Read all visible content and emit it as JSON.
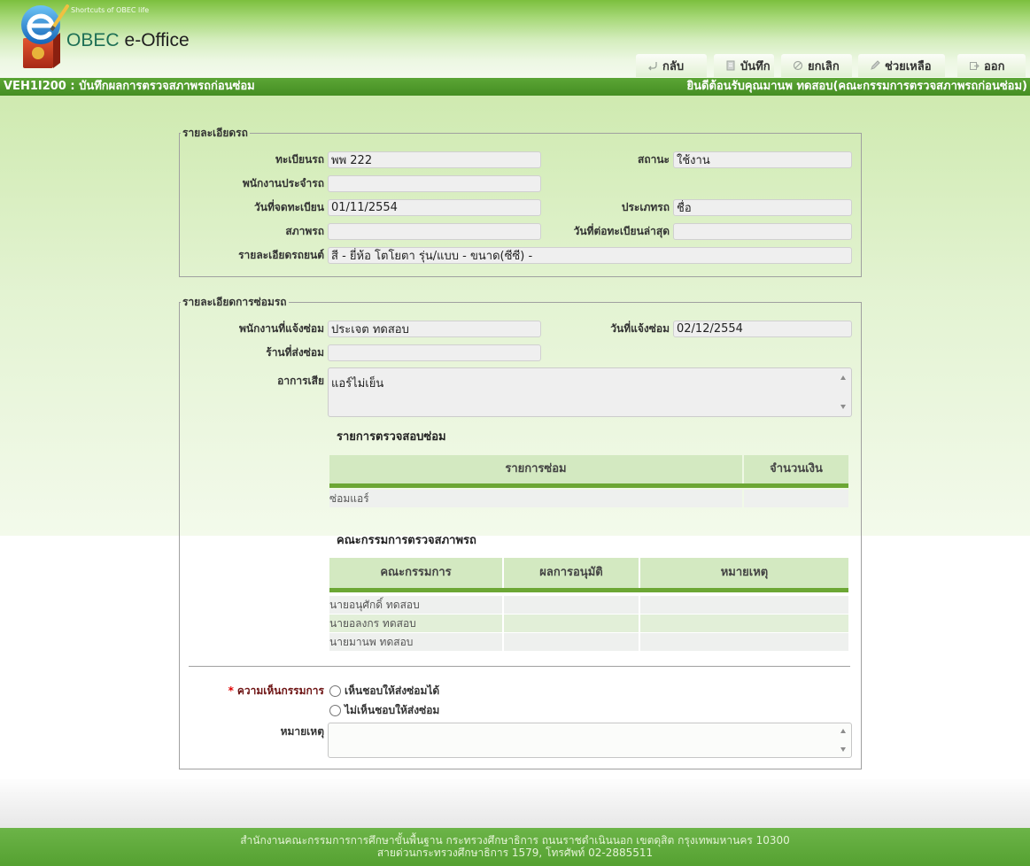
{
  "app": {
    "tagline": "Shortcuts of OBEC life",
    "brand_obec": "OBEC",
    "brand_office": "e-Office",
    "logo_icon": "obec-e-office-logo"
  },
  "toolbar": {
    "back": {
      "label": "กลับ",
      "icon": "back-arrow-icon"
    },
    "save": {
      "label": "บันทึก",
      "icon": "save-document-icon"
    },
    "cancel": {
      "label": "ยกเลิก",
      "icon": "cancel-circle-icon"
    },
    "help": {
      "label": "ช่วยเหลือ",
      "icon": "help-pen-icon"
    },
    "exit": {
      "label": "ออก",
      "icon": "exit-icon"
    }
  },
  "title_bar": {
    "page_title": "VEH1I200 : บันทึกผลการตรวจสภาพรถก่อนซ่อม",
    "welcome": "ยินดีต้อนรับคุณมานพ ทดสอบ(คณะกรรมการตรวจสภาพรถก่อนซ่อม)"
  },
  "vehicle_details": {
    "legend": "รายละเอียดรถ",
    "plate": {
      "label": "ทะเบียนรถ",
      "value": "พพ 222"
    },
    "status": {
      "label": "สถานะ",
      "value": "ใช้งาน"
    },
    "driver": {
      "label": "พนักงานประจำรถ",
      "value": ""
    },
    "registration_date": {
      "label": "วันที่จดทะเบียน",
      "value": "01/11/2554"
    },
    "vehicle_type": {
      "label": "ประเภทรถ",
      "value": "ชื่อ"
    },
    "condition": {
      "label": "สภาพรถ",
      "value": ""
    },
    "last_renewal_date": {
      "label": "วันที่ต่อทะเบียนล่าสุด",
      "value": ""
    },
    "description": {
      "label": "รายละเอียดรถยนต์",
      "value": "สี - ยี่ห้อ โตโยตา รุ่น/แบบ - ขนาด(ซีซี) -"
    }
  },
  "repair_details": {
    "legend": "รายละเอียดการซ่อมรถ",
    "reporter": {
      "label": "พนักงานที่แจ้งซ่อม",
      "value": "ประเจต ทดสอบ"
    },
    "report_date": {
      "label": "วันที่แจ้งซ่อม",
      "value": "02/12/2554"
    },
    "shop": {
      "label": "ร้านที่ส่งซ่อม",
      "value": ""
    },
    "symptom": {
      "label": "อาการเสีย",
      "value": "แอร์ไม่เย็น"
    },
    "checklist": {
      "title": "รายการตรวจสอบซ่อม",
      "headers": [
        "รายการซ่อม",
        "จำนวนเงิน"
      ],
      "rows": [
        [
          "ซ่อมแอร์",
          ""
        ]
      ]
    },
    "committee": {
      "title": "คณะกรรมการตรวจสภาพรถ",
      "headers": [
        "คณะกรรมการ",
        "ผลการอนุมัติ",
        "หมายเหตุ"
      ],
      "rows": [
        [
          "นายอนุศักดิ์ ทดสอบ",
          "",
          ""
        ],
        [
          "นายอลงกร ทดสอบ",
          "",
          ""
        ],
        [
          "นายมานพ ทดสอบ",
          "",
          ""
        ]
      ]
    },
    "opinion": {
      "required_mark": "*",
      "label": "ความเห็นกรรมการ",
      "options": [
        "เห็นชอบให้ส่งซ่อมได้",
        "ไม่เห็นชอบให้ส่งซ่อม"
      ]
    },
    "remark": {
      "label": "หมายเหตุ",
      "value": ""
    }
  },
  "footer": {
    "line1": "สำนักงานคณะกรรมการการศึกษาขั้นพื้นฐาน กระทรวงศึกษาธิการ ถนนราชดำเนินนอก เขตดุสิต กรุงเทพมหานคร 10300",
    "line2": "สายด่วนกระทรวงศึกษาธิการ 1579, โทรศัพท์ 02-2885511"
  },
  "colors": {
    "title_bar": "#4f9a2a",
    "table_header": "#d3e9c1",
    "table_header_rule": "#6ca734",
    "required_mark": "#e00000",
    "footer": "#5fab3c"
  }
}
